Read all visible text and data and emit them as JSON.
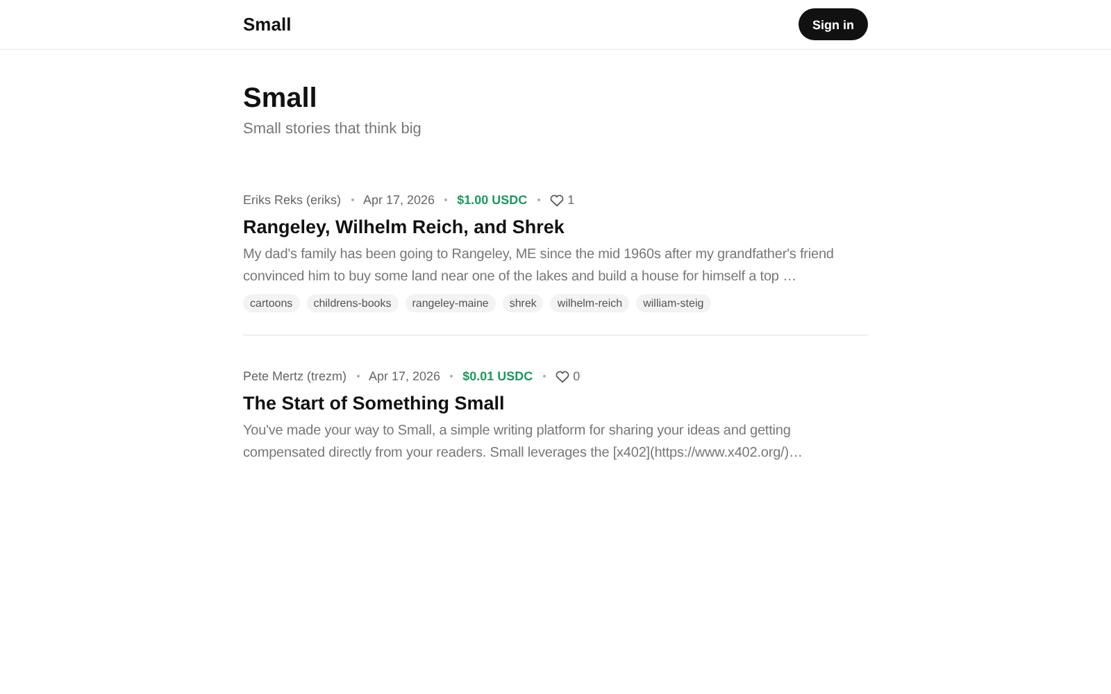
{
  "header": {
    "logo": "Small",
    "sign_in": "Sign in"
  },
  "hero": {
    "title": "Small",
    "tagline": "Small stories that think big"
  },
  "posts": [
    {
      "author": "Eriks Reks (eriks)",
      "date": "Apr 17, 2026",
      "price": "$1.00 USDC",
      "likes": "1",
      "title": "Rangeley, Wilhelm Reich, and Shrek",
      "excerpt": "My dad's family has been going to Rangeley, ME since the mid 1960s after my grandfather's friend convinced him to buy some land near one of the lakes and build a house for himself a top …",
      "tags": [
        "cartoons",
        "childrens-books",
        "rangeley-maine",
        "shrek",
        "wilhelm-reich",
        "william-steig"
      ]
    },
    {
      "author": "Pete Mertz (trezm)",
      "date": "Apr 17, 2026",
      "price": "$0.01 USDC",
      "likes": "0",
      "title": "The Start of Something Small",
      "excerpt": "You've made your way to Small, a simple writing platform for sharing your ideas and getting compensated directly from your readers. Small leverages the [x402](https://www.x402.org/)…"
    }
  ]
}
